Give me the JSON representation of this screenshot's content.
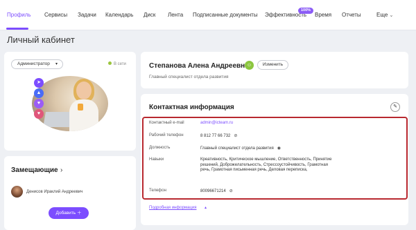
{
  "nav": {
    "tabs": [
      {
        "label": "Профиль",
        "active": true
      },
      {
        "label": "Сервисы"
      },
      {
        "label": "Задачи"
      },
      {
        "label": "Календарь"
      },
      {
        "label": "Диск"
      },
      {
        "label": "Лента"
      },
      {
        "label": "Подписанные документы"
      },
      {
        "label": "Эффективность",
        "badge": "100%"
      },
      {
        "label": "Время"
      },
      {
        "label": "Отчеты"
      },
      {
        "label": "Еще"
      }
    ],
    "accent_color": "#7c4dff"
  },
  "page_title": "Личный кабинет",
  "profile_card": {
    "role_select": "Администратор",
    "status": "В сети",
    "status_color": "#9bc53d",
    "achievement_icons": [
      "rocket-icon",
      "cap-icon",
      "heart-icon",
      "handshake-icon"
    ]
  },
  "subordinates": {
    "title": "Замещающие",
    "person_name": "Денисов Ираклий Андреевич",
    "add_button": "Добавить"
  },
  "header_card": {
    "full_name": "Степанова Алена Андреевна",
    "edit_button": "Изменить",
    "position": "Главный специалист отдела развития"
  },
  "contacts": {
    "title": "Контактная информация",
    "highlight_color": "#b8282f",
    "rows": {
      "email": {
        "label": "Контактный e-mail",
        "value": "admin@icteam.ru"
      },
      "work_phone": {
        "label": "Рабочий телефон",
        "value": "8 812 77 66 732"
      },
      "job": {
        "label": "Должность",
        "value": "Главный специалист отдела развития"
      },
      "skills": {
        "label": "Навыки",
        "value": "Креативность, Критическое мышление, Ответственность, Принятие решений, Доброжелательность, Стрессоустойчивость, Грамотная речь, Грамотная письменная речь, Деловая переписка,"
      },
      "phone": {
        "label": "Телефон",
        "value": "80096671214"
      }
    },
    "more_link": "Подробная информация"
  }
}
